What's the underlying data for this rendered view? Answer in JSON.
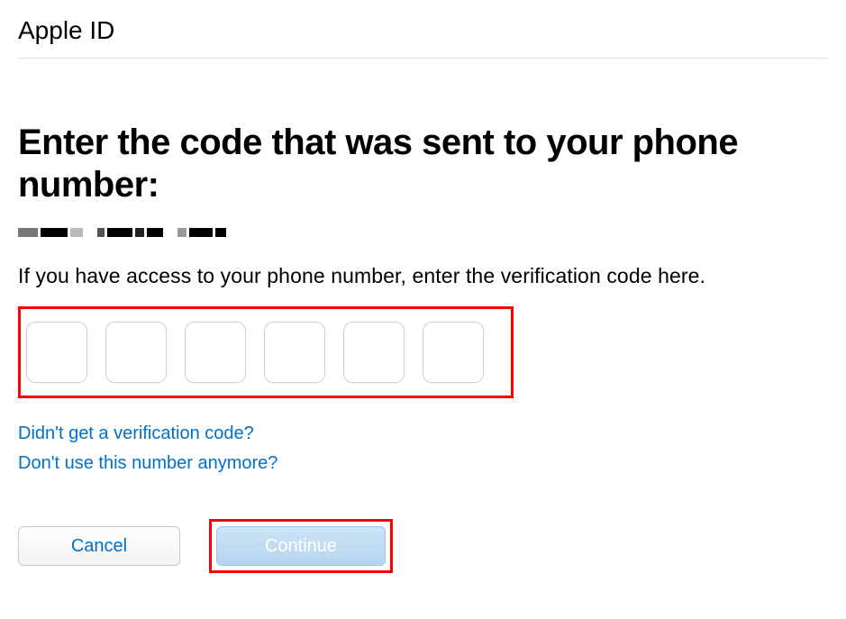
{
  "header": {
    "title": "Apple ID"
  },
  "main": {
    "heading": "Enter the code that was sent to your phone number:",
    "phone_redacted": true,
    "instruction": "If you have access to your phone number, enter the verification code here.",
    "code_digits": [
      "",
      "",
      "",
      "",
      "",
      ""
    ]
  },
  "links": {
    "resend": "Didn't get a verification code?",
    "change_number": "Don't use this number anymore?"
  },
  "buttons": {
    "cancel": "Cancel",
    "continue": "Continue"
  },
  "highlights": {
    "code_inputs": true,
    "continue_button": true
  },
  "colors": {
    "link": "#0070c9",
    "highlight": "#ff0000"
  }
}
